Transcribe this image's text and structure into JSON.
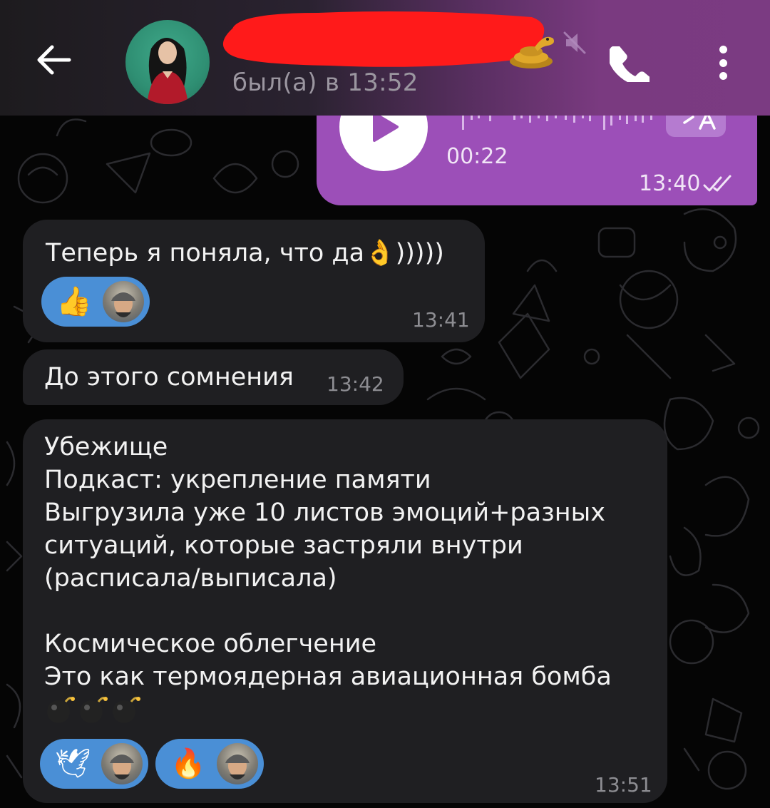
{
  "header": {
    "status": "был(а) в 13:52",
    "icons": {
      "back": "arrow-left-icon",
      "snake": "snake-emoji-icon",
      "mute": "muted-speaker-icon",
      "call": "phone-icon",
      "menu": "more-vertical-icon"
    }
  },
  "voice_message": {
    "duration": "00:22",
    "time": "13:40",
    "status": "read"
  },
  "messages": [
    {
      "text": "Теперь я поняла, что да👌)))))",
      "time": "13:41",
      "reactions": [
        {
          "emoji": "👍"
        }
      ]
    },
    {
      "text": "До этого сомнения",
      "time": "13:42"
    },
    {
      "text": "Убежище\nПодкаст: укрепление памяти\nВыгрузила уже 10 листов эмоций+разных\nситуаций, которые застряли внутри\n(расписала/выписала)\n\nКосмическое облегчение\nЭто как термоядерная авиационная бомба",
      "emoji_line": "💣💣💣",
      "time": "13:51",
      "reactions": [
        {
          "emoji": "🕊"
        },
        {
          "emoji": "🔥"
        }
      ]
    }
  ],
  "colors": {
    "outgoing_bubble": "#9c4fb8",
    "incoming_bubble": "#1f1f22",
    "reaction_pill": "#4a8fd6",
    "redaction": "#ff1a1a"
  }
}
